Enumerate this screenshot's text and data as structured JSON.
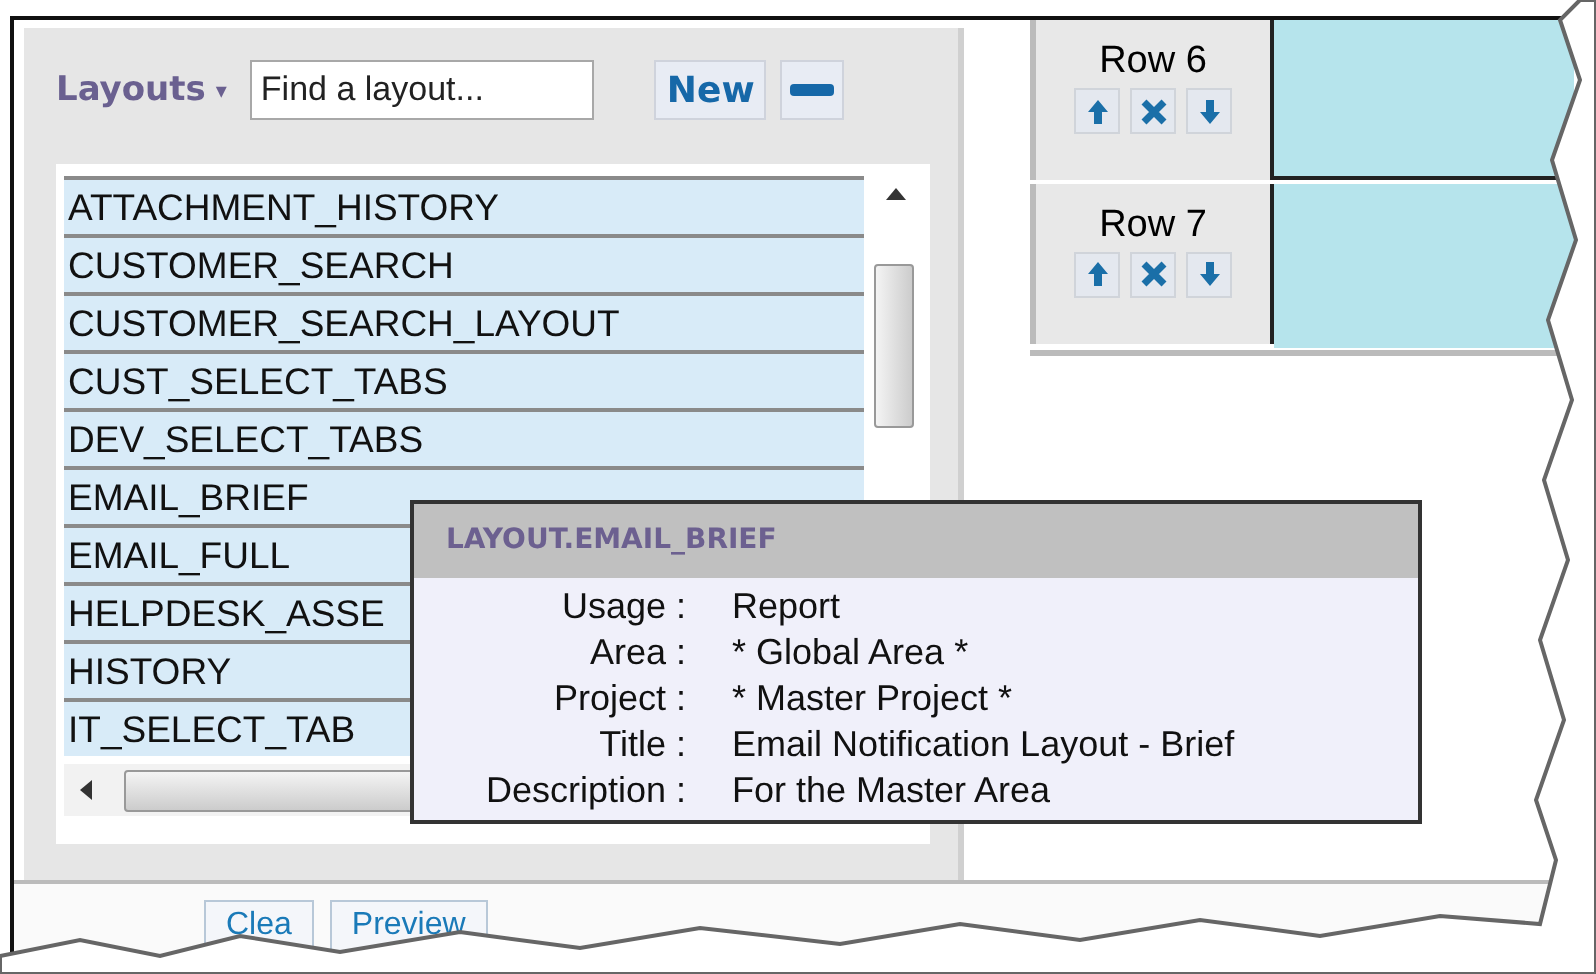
{
  "layouts_panel": {
    "menu_label": "Layouts",
    "menu_caret": "▾",
    "search": {
      "placeholder": "Find a layout..."
    },
    "new_button": "New",
    "items": [
      {
        "label": "ATTACHMENT_HISTORY"
      },
      {
        "label": "CUSTOMER_SEARCH"
      },
      {
        "label": "CUSTOMER_SEARCH_LAYOUT"
      },
      {
        "label": "CUST_SELECT_TABS"
      },
      {
        "label": "DEV_SELECT_TABS"
      },
      {
        "label": "EMAIL_BRIEF"
      },
      {
        "label": "EMAIL_FULL"
      },
      {
        "label": "HELPDESK_ASSE"
      },
      {
        "label": "HISTORY"
      },
      {
        "label": "IT_SELECT_TAB"
      }
    ]
  },
  "rows": [
    {
      "label": "Row 6"
    },
    {
      "label": "Row 7"
    }
  ],
  "tooltip": {
    "title": "LAYOUT.EMAIL_BRIEF",
    "fields": [
      {
        "label": "Usage :",
        "value": "Report"
      },
      {
        "label": "Area :",
        "value": "* Global Area *"
      },
      {
        "label": "Project :",
        "value": "* Master Project *"
      },
      {
        "label": "Title :",
        "value": "Email Notification Layout - Brief"
      },
      {
        "label": "Description :",
        "value": "For the Master Area"
      }
    ]
  },
  "bottom_buttons": [
    {
      "label": "Clea"
    },
    {
      "label": "Preview"
    }
  ]
}
